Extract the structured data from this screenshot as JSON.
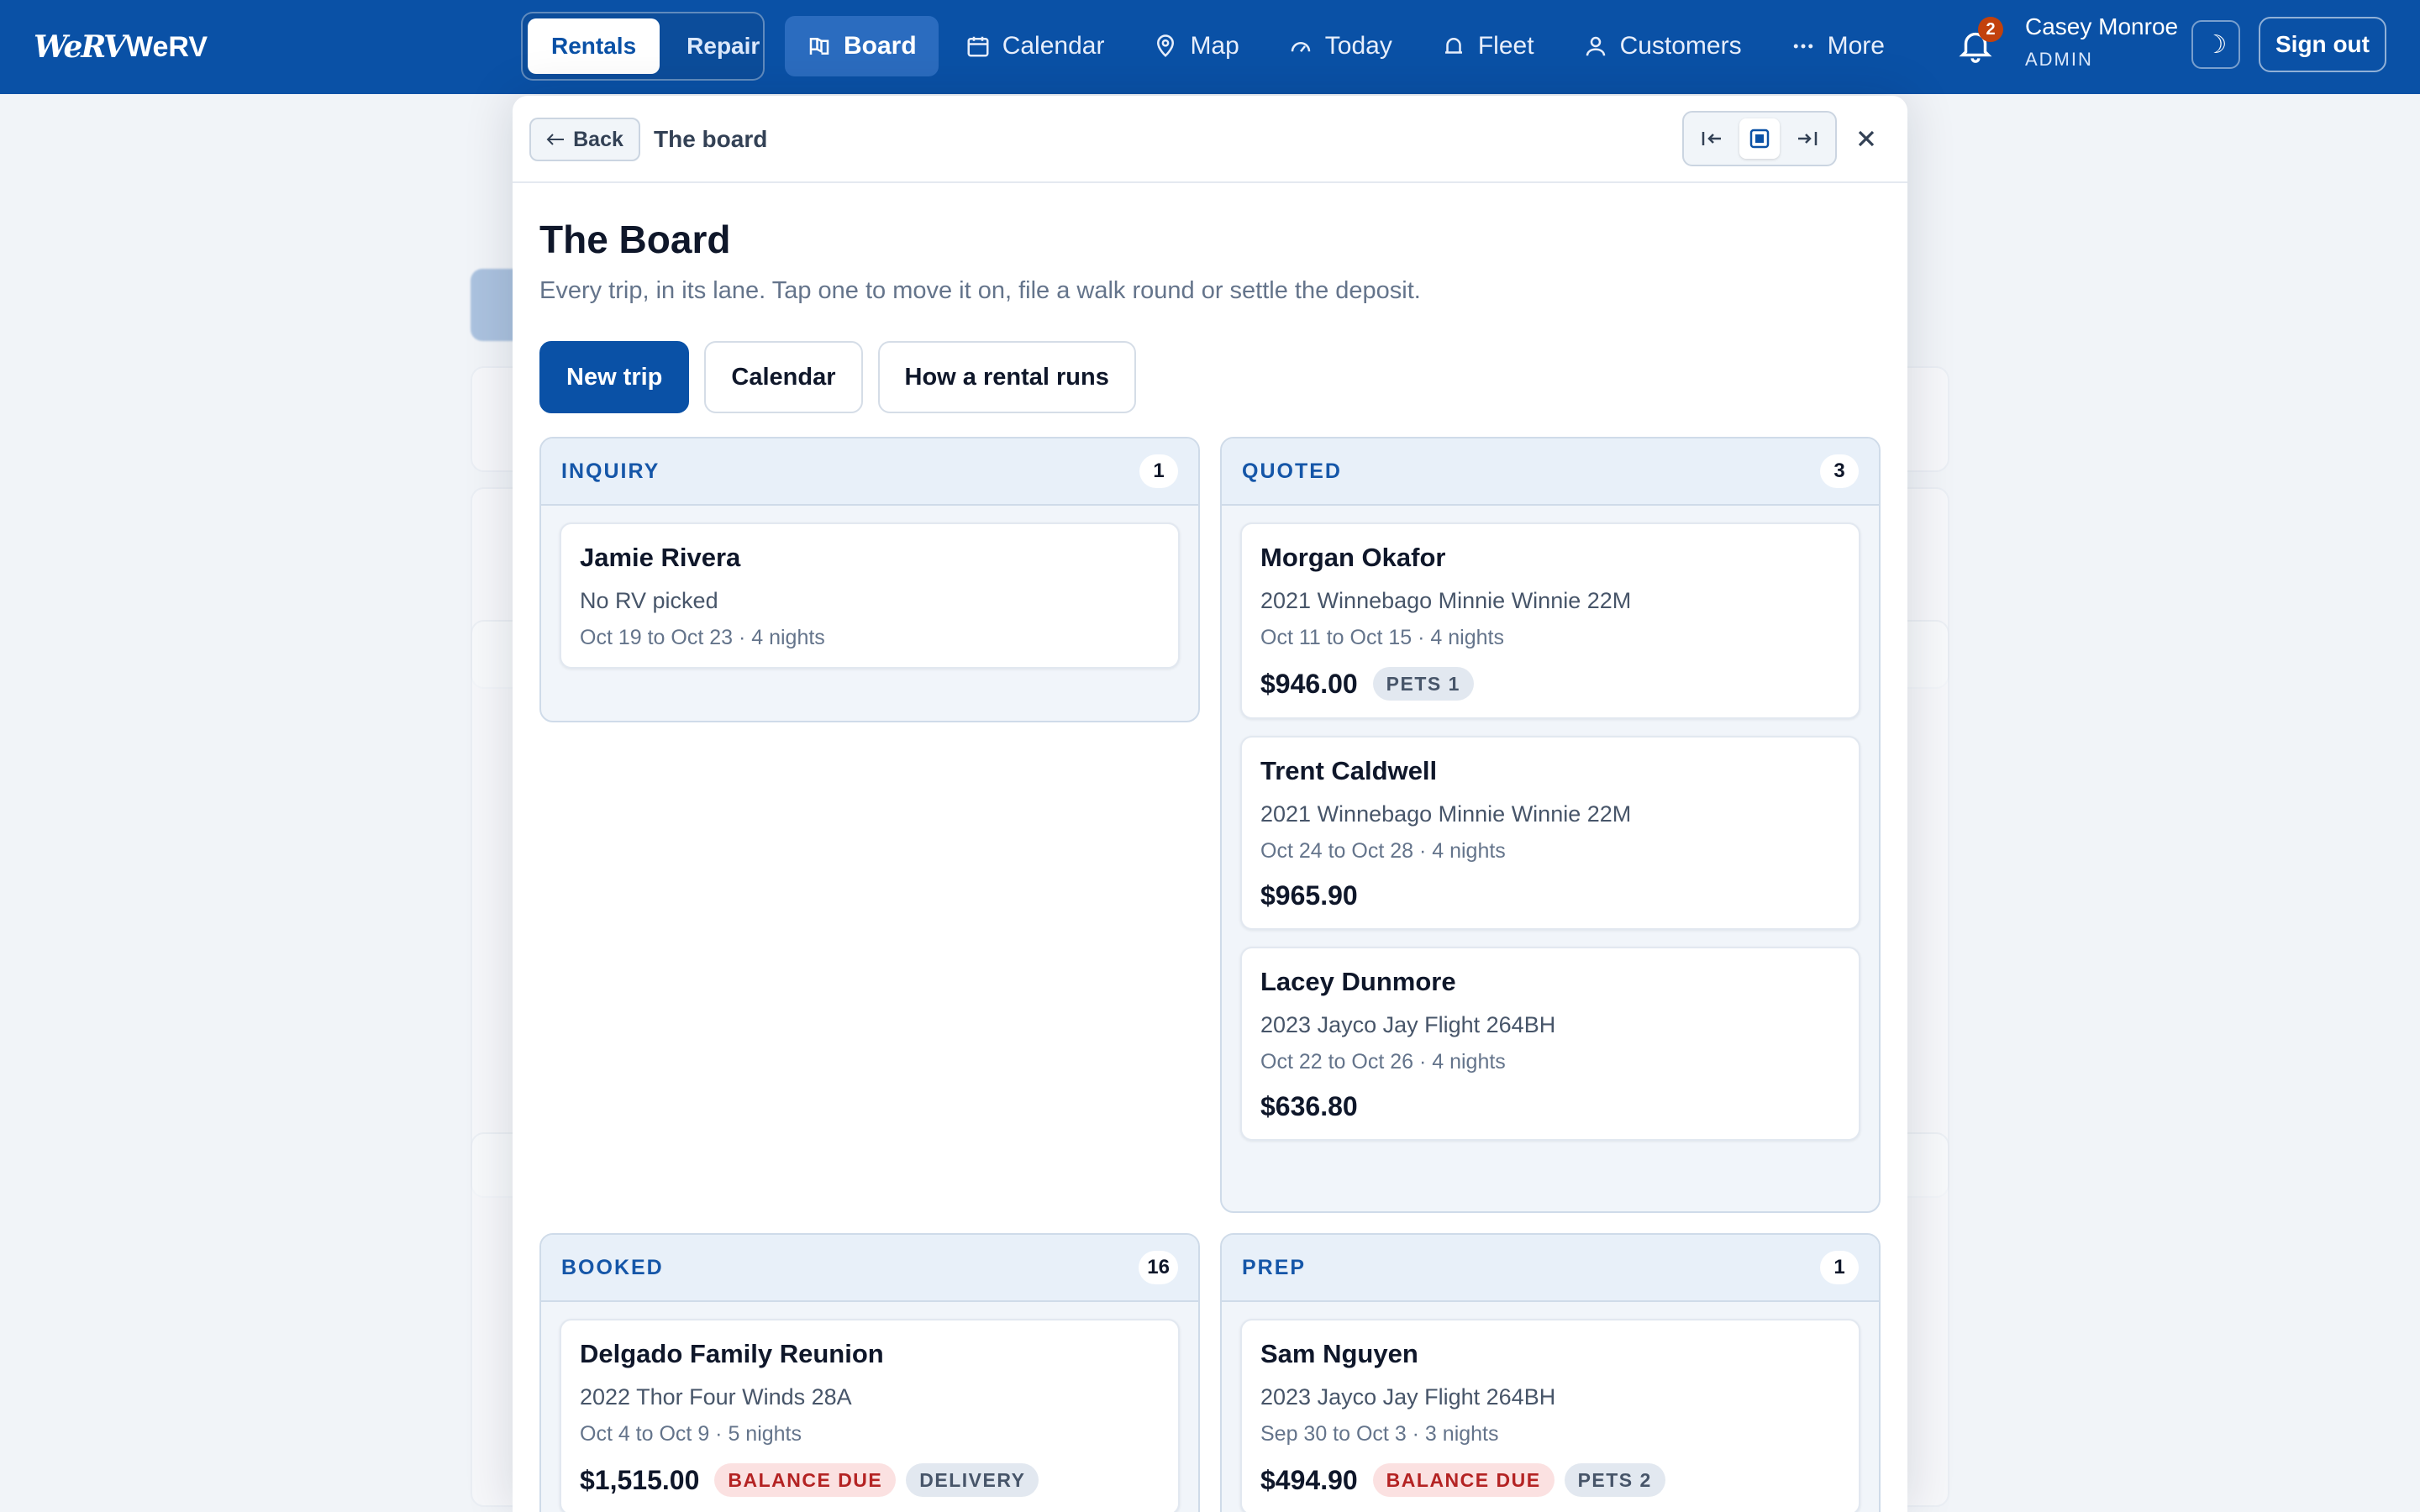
{
  "brand": {
    "logo_text": "WeRV",
    "name": "WeRV"
  },
  "mode_switch": {
    "options": [
      "Rentals",
      "Repair"
    ],
    "active": "Rentals"
  },
  "nav": {
    "items": [
      {
        "label": "Board",
        "icon": "board-icon"
      },
      {
        "label": "Calendar",
        "icon": "calendar-icon"
      },
      {
        "label": "Map",
        "icon": "map-pin-icon"
      },
      {
        "label": "Today",
        "icon": "gauge-icon"
      },
      {
        "label": "Fleet",
        "icon": "rv-icon"
      },
      {
        "label": "Customers",
        "icon": "person-icon"
      },
      {
        "label": "More",
        "icon": "dots-icon"
      }
    ],
    "active": "Board"
  },
  "notifications": {
    "count": "2"
  },
  "user": {
    "name": "Casey Monroe",
    "role": "ADMIN"
  },
  "header_actions": {
    "theme_icon": "☽",
    "sign_out": "Sign out"
  },
  "panel": {
    "back_label": "Back",
    "breadcrumb": "The board",
    "title": "The Board",
    "description": "Every trip, in its lane. Tap one to move it on, file a walk round or settle the deposit.",
    "actions": {
      "new_trip": "New trip",
      "calendar": "Calendar",
      "how": "How a rental runs"
    }
  },
  "lanes": {
    "inquiry": {
      "name": "INQUIRY",
      "count": "1",
      "cards": [
        {
          "name": "Jamie Rivera",
          "rv": "No RV picked",
          "dates": "Oct 19 to Oct 23 · 4 nights"
        }
      ]
    },
    "quoted": {
      "name": "QUOTED",
      "count": "3",
      "cards": [
        {
          "name": "Morgan Okafor",
          "rv": "2021 Winnebago Minnie Winnie 22M",
          "dates": "Oct 11 to Oct 15 · 4 nights",
          "price": "$946.00",
          "tags": [
            "PETS 1"
          ]
        },
        {
          "name": "Trent Caldwell",
          "rv": "2021 Winnebago Minnie Winnie 22M",
          "dates": "Oct 24 to Oct 28 · 4 nights",
          "price": "$965.90"
        },
        {
          "name": "Lacey Dunmore",
          "rv": "2023 Jayco Jay Flight 264BH",
          "dates": "Oct 22 to Oct 26 · 4 nights",
          "price": "$636.80"
        }
      ]
    },
    "booked": {
      "name": "BOOKED",
      "count": "16",
      "cards": [
        {
          "name": "Delgado Family Reunion",
          "rv": "2022 Thor Four Winds 28A",
          "dates": "Oct 4 to Oct 9 · 5 nights",
          "price": "$1,515.00",
          "tags": [
            "BALANCE DUE",
            "DELIVERY"
          ]
        }
      ]
    },
    "prep": {
      "name": "PREP",
      "count": "1",
      "cards": [
        {
          "name": "Sam Nguyen",
          "rv": "2023 Jayco Jay Flight 264BH",
          "dates": "Sep 30 to Oct 3 · 3 nights",
          "price": "$494.90",
          "tags": [
            "BALANCE DUE",
            "PETS 2"
          ]
        }
      ]
    }
  },
  "colors": {
    "brand_blue": "#0a51a6",
    "lane_label": "#1556a8",
    "alert_red": "#b42323",
    "badge_orange": "#c2410c"
  }
}
